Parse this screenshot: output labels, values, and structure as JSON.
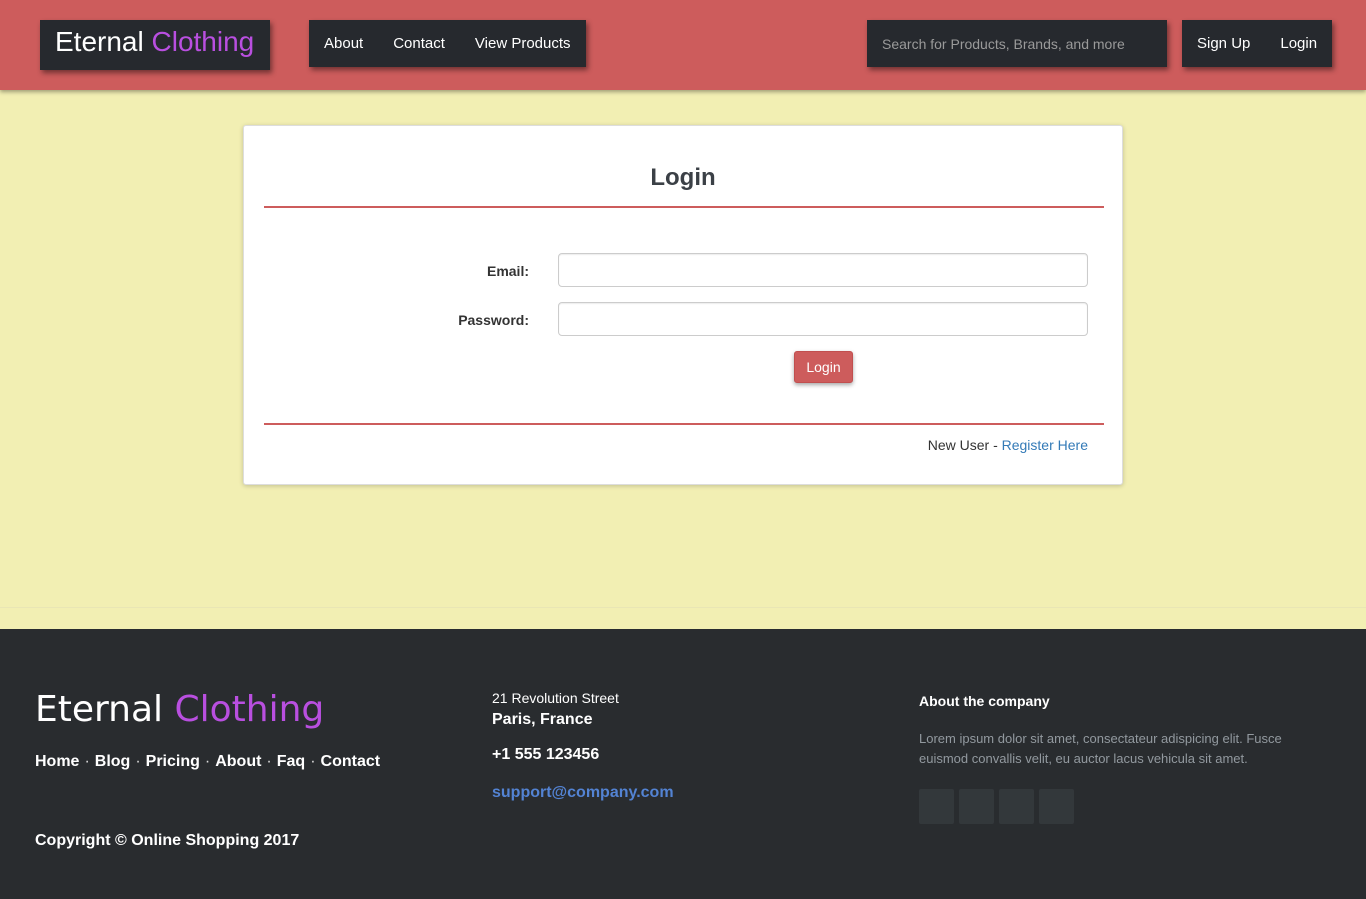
{
  "header": {
    "brand": {
      "name": "Eternal",
      "accent": "Clothing"
    },
    "nav_left": [
      "About",
      "Contact",
      "View Products"
    ],
    "search_placeholder": "Search for Products, Brands, and more",
    "nav_right": [
      "Sign Up",
      "Login"
    ]
  },
  "login_form": {
    "title": "Login",
    "email_label": "Email:",
    "password_label": "Password:",
    "email_value": "",
    "password_value": "",
    "submit_label": "Login",
    "new_user_text": "New User - ",
    "register_link": "Register Here"
  },
  "footer": {
    "brand": {
      "name": "Eternal",
      "accent": "Clothing"
    },
    "links": [
      "Home",
      "Blog",
      "Pricing",
      "About",
      "Faq",
      "Contact"
    ],
    "link_separator": "·",
    "copyright": "Copyright © Online Shopping 2017",
    "address_line1": "21 Revolution Street",
    "address_line2": "Paris, France",
    "phone": "+1 555 123456",
    "email": "support@company.com",
    "about_title": "About the company",
    "about_text": "Lorem ipsum dolor sit amet, consectateur adispicing elit. Fusce euismod convallis velit, eu auctor lacus vehicula sit amet."
  },
  "colors": {
    "header_bg": "#cd5c5c",
    "dark": "#26292e",
    "page_bg": "#f2efb3",
    "accent_purple": "#b94fe0",
    "link_blue": "#337ab7",
    "footer_bg": "#292c2f"
  }
}
